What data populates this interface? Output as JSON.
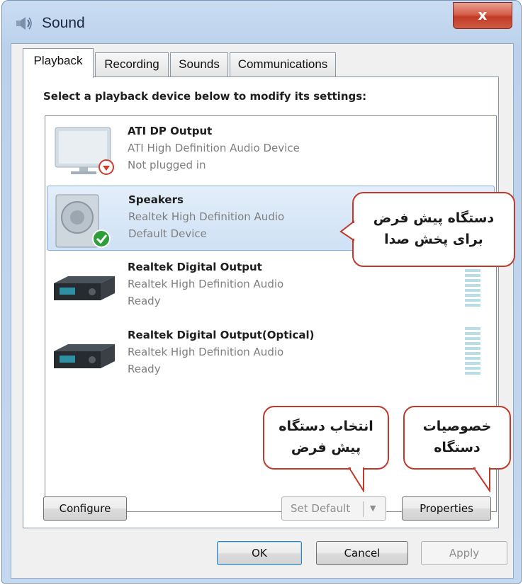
{
  "window": {
    "title": "Sound",
    "close_label": "x"
  },
  "tabs": [
    {
      "label": "Playback",
      "active": true
    },
    {
      "label": "Recording",
      "active": false
    },
    {
      "label": "Sounds",
      "active": false
    },
    {
      "label": "Communications",
      "active": false
    }
  ],
  "playback": {
    "instruction": "Select a playback device below to modify its settings:",
    "devices": [
      {
        "name": "ATI DP Output",
        "description": "ATI High Definition Audio Device",
        "status": "Not plugged in",
        "icon": "monitor-icon",
        "badge": "unplugged-badge-icon",
        "selected": false
      },
      {
        "name": "Speakers",
        "description": "Realtek High Definition Audio",
        "status": "Default Device",
        "icon": "speaker-icon",
        "badge": "default-check-badge-icon",
        "selected": true
      },
      {
        "name": "Realtek Digital Output",
        "description": "Realtek High Definition Audio",
        "status": "Ready",
        "icon": "digital-output-device-icon",
        "selected": false
      },
      {
        "name": "Realtek Digital Output(Optical)",
        "description": "Realtek High Definition Audio",
        "status": "Ready",
        "icon": "digital-output-device-icon",
        "selected": false
      }
    ],
    "buttons": {
      "configure": "Configure",
      "set_default": "Set Default",
      "properties": "Properties"
    }
  },
  "footer": {
    "ok": "OK",
    "cancel": "Cancel",
    "apply": "Apply"
  },
  "annotations": {
    "default_device": [
      "دستگاه پیش فرض",
      "برای پخش صدا"
    ],
    "select_default": [
      "انتخاب دستگاه",
      "پیش فرض"
    ],
    "properties": [
      "خصوصیات",
      "دستگاه"
    ]
  },
  "colors": {
    "selection": "#cfe1f5",
    "callout_border": "#c0392b",
    "close_button": "#c23b26",
    "default_badge": "#2e9e3a"
  }
}
